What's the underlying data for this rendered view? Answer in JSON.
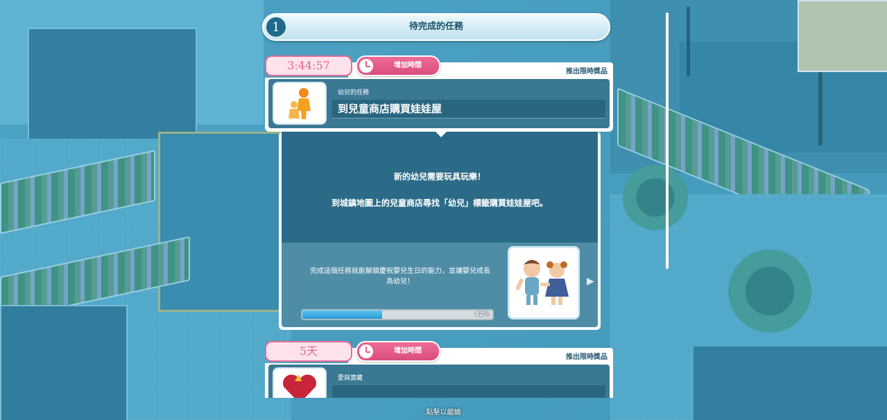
{
  "header": {
    "number": "1",
    "title": "待完成的任務"
  },
  "tasks": [
    {
      "timer": "3:44:57",
      "add_time_label": "增加時間",
      "limited_label": "推出限時獎品",
      "category": "幼兒的任務",
      "title": "到兒童商店購買娃娃屋",
      "icon": "toddler-icon"
    },
    {
      "timer": "5天",
      "add_time_label": "增加時間",
      "limited_label": "推出限時獎品",
      "category": "愛與寶藏",
      "title": "",
      "icon": "heart-treasure-icon"
    }
  ],
  "detail": {
    "line1": "新的幼兒需要玩具玩樂！",
    "line2": "到城鎮地圖上的兒童商店尋找「幼兒」標籤購買娃娃屋吧。",
    "reward_text": "完成這個任務就能解鎖慶祝嬰兒生日的能力，並讓嬰兒成長為幼兒！",
    "progress_percent": 42,
    "progress_label": "42%",
    "reward_icon": "toddlers-reward-icon"
  },
  "footer": {
    "continue_text": "點擊以繼續"
  },
  "colors": {
    "accent_pink": "#e86a94",
    "panel_blue": "#2b6b87",
    "progress_blue": "#2a9ad6"
  }
}
